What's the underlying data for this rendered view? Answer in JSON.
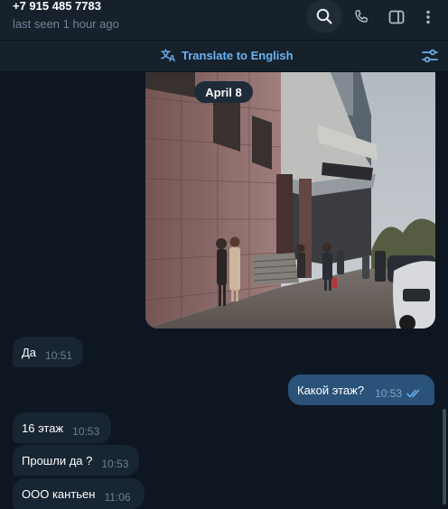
{
  "header": {
    "title": "+7 915 485 7783",
    "status": "last seen 1 hour ago"
  },
  "translate": {
    "label": "Translate to English"
  },
  "chat": {
    "date": "April 8",
    "messages": [
      {
        "dir": "in",
        "text": "Да",
        "time": "10:51"
      },
      {
        "dir": "out",
        "text": "Какой этаж?",
        "time": "10:53"
      },
      {
        "dir": "in",
        "text": "16 этаж",
        "time": "10:53"
      },
      {
        "dir": "in",
        "text": "Прошли да ?",
        "time": "10:53"
      },
      {
        "dir": "in",
        "text": "ООО кантьен",
        "time": "11:06"
      }
    ]
  },
  "colors": {
    "accent": "#6ab3f3",
    "incoming_bubble": "#182533",
    "outgoing_bubble": "#2b5278",
    "background": "#0e1621"
  }
}
